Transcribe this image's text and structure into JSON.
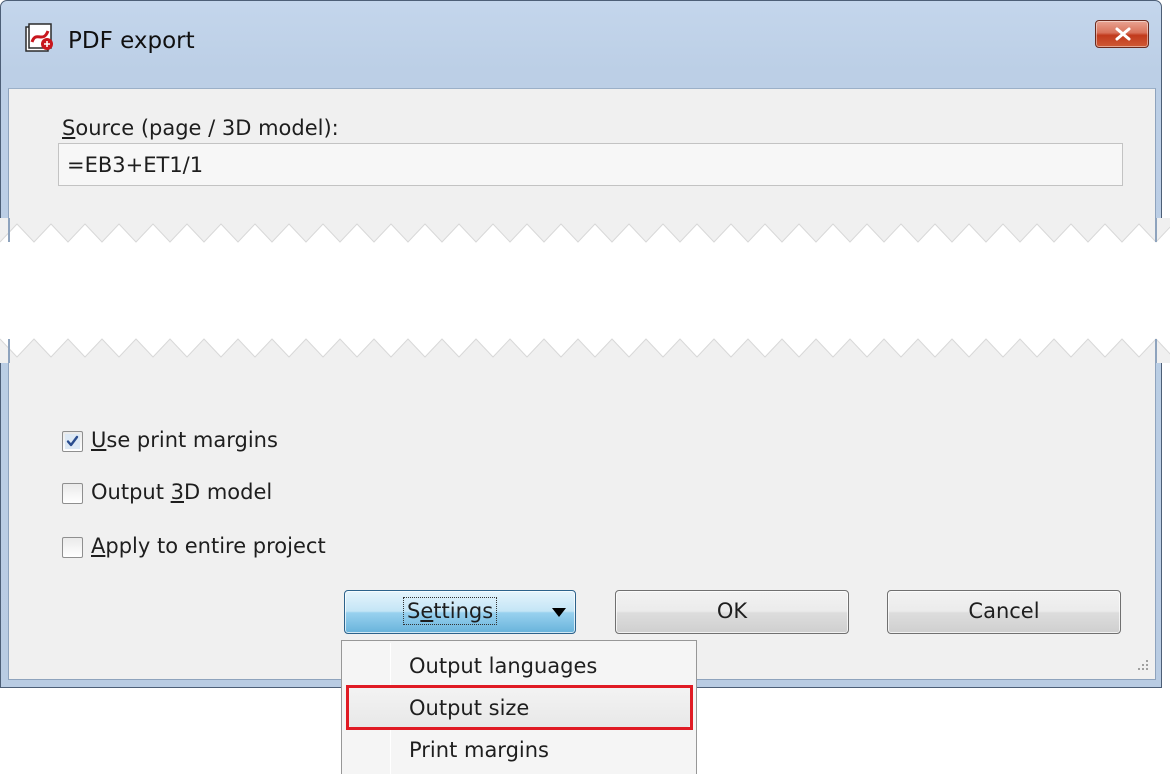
{
  "window": {
    "title": "PDF export",
    "icon": "pdf-export-app-icon",
    "close_icon": "close-icon"
  },
  "source": {
    "label_underlined": "S",
    "label_rest": "ource (page / 3D model):",
    "value": "=EB3+ET1/1"
  },
  "options": [
    {
      "prefix": "",
      "underlined": "U",
      "suffix": "se print margins",
      "checked": true
    },
    {
      "prefix": "Output ",
      "underlined": "3",
      "suffix": "D model",
      "checked": false
    },
    {
      "prefix": "",
      "underlined": "A",
      "suffix": "pply to entire project",
      "checked": false
    }
  ],
  "buttons": {
    "settings_prefix": "S",
    "settings_underlined": "e",
    "settings_suffix": "ttings",
    "settings_icon": "dropdown-arrow-icon",
    "ok": "OK",
    "cancel": "Cancel"
  },
  "menu": {
    "items": [
      {
        "label": "Output languages"
      },
      {
        "label": "Output size"
      },
      {
        "label": "Print margins"
      }
    ],
    "highlighted_item": "Output size"
  },
  "colors": {
    "highlight_box": "#e01b24",
    "settings_button": "#98d1ef",
    "title_bar": "#c4d6ec",
    "close_button": "#c13a1c"
  }
}
